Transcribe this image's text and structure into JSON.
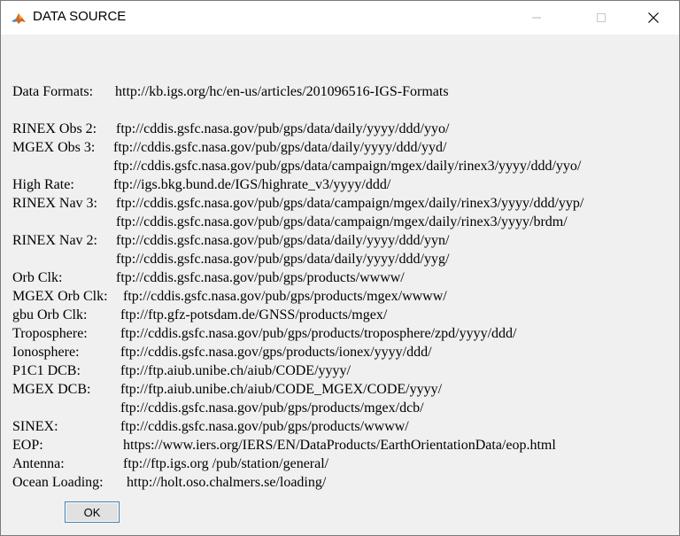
{
  "window": {
    "title": "DATA SOURCE"
  },
  "icons": {
    "app": "matlab-icon",
    "minimize": "minimize-icon",
    "maximize": "maximize-icon",
    "close": "close-icon"
  },
  "formats": {
    "label": "Data Formats:",
    "url": "http://kb.igs.org/hc/en-us/articles/201096516-IGS-Formats"
  },
  "rows": [
    {
      "label": "RINEX Obs 2:",
      "url": "ftp://cddis.gsfc.nasa.gov/pub/gps/data/daily/yyyy/ddd/yyo/"
    },
    {
      "label": "MGEX Obs 3:",
      "url": "ftp://cddis.gsfc.nasa.gov/pub/gps/data/daily/yyyy/ddd/yyd/"
    },
    {
      "label": "",
      "url": "ftp://cddis.gsfc.nasa.gov/pub/gps/data/campaign/mgex/daily/rinex3/yyyy/ddd/yyo/"
    },
    {
      "label": "High Rate:",
      "url": "ftp://igs.bkg.bund.de/IGS/highrate_v3/yyyy/ddd/"
    },
    {
      "label": "RINEX Nav 3:",
      "url": "ftp://cddis.gsfc.nasa.gov/pub/gps/data/campaign/mgex/daily/rinex3/yyyy/ddd/yyp/"
    },
    {
      "label": "",
      "url": "ftp://cddis.gsfc.nasa.gov/pub/gps/data/campaign/mgex/daily/rinex3/yyyy/brdm/"
    },
    {
      "label": "RINEX Nav 2:",
      "url": "ftp://cddis.gsfc.nasa.gov/pub/gps/data/daily/yyyy/ddd/yyn/"
    },
    {
      "label": "",
      "url": "ftp://cddis.gsfc.nasa.gov/pub/gps/data/daily/yyyy/ddd/yyg/"
    },
    {
      "label": "Orb Clk:",
      "url": "ftp://cddis.gsfc.nasa.gov/pub/gps/products/wwww/"
    },
    {
      "label": "MGEX Orb Clk:",
      "url": "ftp://cddis.gsfc.nasa.gov/pub/gps/products/mgex/wwww/"
    },
    {
      "label": "gbu Orb Clk:",
      "url": "ftp://ftp.gfz-potsdam.de/GNSS/products/mgex/"
    },
    {
      "label": "Troposphere:",
      "url": "ftp://cddis.gsfc.nasa.gov/pub/gps/products/troposphere/zpd/yyyy/ddd/"
    },
    {
      "label": "Ionosphere:",
      "url": "ftp://cddis.gsfc.nasa.gov/gps/products/ionex/yyyy/ddd/"
    },
    {
      "label": "P1C1 DCB:",
      "url": "ftp://ftp.aiub.unibe.ch/aiub/CODE/yyyy/"
    },
    {
      "label": "MGEX DCB:",
      "url": "ftp://ftp.aiub.unibe.ch/aiub/CODE_MGEX/CODE/yyyy/"
    },
    {
      "label": "",
      "url": "ftp://cddis.gsfc.nasa.gov/pub/gps/products/mgex/dcb/"
    },
    {
      "label": "SINEX:",
      "url": "ftp://cddis.gsfc.nasa.gov/pub/gps/products/wwww/"
    },
    {
      "label": "EOP:",
      "url": "https://www.iers.org/IERS/EN/DataProducts/EarthOrientationData/eop.html"
    },
    {
      "label": "Antenna:",
      "url": "ftp://ftp.igs.org /pub/station/general/"
    },
    {
      "label": "Ocean Loading:",
      "url": "http://holt.oso.chalmers.se/loading/"
    }
  ],
  "ok_button": {
    "label": "OK"
  }
}
